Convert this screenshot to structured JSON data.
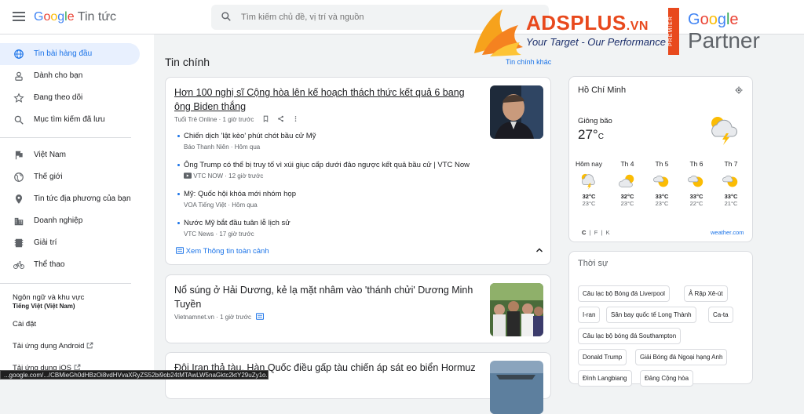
{
  "header": {
    "menu_icon": "hamburger-menu-icon",
    "logo_google": [
      "G",
      "o",
      "o",
      "g",
      "l",
      "e"
    ],
    "logo_suffix": "Tin tức",
    "search_placeholder": "Tìm kiếm chủ đề, vị trí và nguồn",
    "search_icon": "search-icon"
  },
  "watermark": {
    "brand": "ADSPLUS",
    "brand_suffix": ".VN",
    "tagline": "Your Target - Our Performance",
    "premier": "PREMIER",
    "partner_google": [
      "G",
      "o",
      "o",
      "g",
      "l",
      "e"
    ],
    "partner": "Partner"
  },
  "sidebar": {
    "items": [
      {
        "label": "Tin bài hàng đầu",
        "icon": "globe-icon",
        "active": true
      },
      {
        "label": "Dành cho bạn",
        "icon": "person-icon"
      },
      {
        "label": "Đang theo dõi",
        "icon": "star-icon"
      },
      {
        "label": "Mục tìm kiếm đã lưu",
        "icon": "search-icon"
      },
      {
        "label": "Việt Nam",
        "icon": "flag-icon"
      },
      {
        "label": "Thế giới",
        "icon": "world-icon"
      },
      {
        "label": "Tin tức địa phương của bạn",
        "icon": "location-pin-icon"
      },
      {
        "label": "Doanh nghiệp",
        "icon": "building-icon"
      },
      {
        "label": "Giải trí",
        "icon": "film-icon"
      },
      {
        "label": "Thể thao",
        "icon": "bicycle-icon"
      }
    ],
    "lang_label": "Ngôn ngữ và khu vực",
    "lang_value": "Tiếng Việt (Việt Nam)",
    "settings": "Cài đặt",
    "android": "Tải ứng dụng Android",
    "ios": "Tải ứng dụng iOS"
  },
  "main": {
    "title": "Tin chính",
    "more": "Tin chính khác",
    "story1": {
      "headline": "Hơn 100 nghị sĩ Cộng hòa lên kế hoạch thách thức kết quả 6 bang ông Biden thắng",
      "source": "Tuổi Trẻ Online",
      "time": "1 giờ trước",
      "related": [
        {
          "title": "Chiến dịch 'lật kèo' phút chót bầu cử Mỹ",
          "source": "Báo Thanh Niên",
          "time": "Hôm qua"
        },
        {
          "title": "Ông Trump có thể bị truy tố vì xúi giục cấp dưới đảo ngược kết quả bầu cử | VTC Now",
          "source": "VTC NOW",
          "time": "12 giờ trước"
        },
        {
          "title": "Mỹ: Quốc hội khóa mới nhóm họp",
          "source": "VOA Tiếng Việt",
          "time": "Hôm qua"
        },
        {
          "title": "Nước Mỹ bắt đầu tuân lễ lịch sử",
          "source": "VTC News",
          "time": "17 giờ trước"
        }
      ],
      "coverage": "Xem Thông tin toàn cảnh"
    },
    "story2": {
      "headline": "Nổ súng ở Hải Dương, kẻ lạ mặt nhâm vào 'thánh chửi' Dương Minh Tuyền",
      "source": "Vietnamnet.vn",
      "time": "1 giờ trước"
    },
    "story3": {
      "headline": "Đội Iran thả tàu, Hàn Quốc điều gấp tàu chiến áp sát eo biển Hormuz"
    }
  },
  "weather": {
    "city": "Hồ Chí Minh",
    "condition": "Giông bão",
    "temp": "27°",
    "unit": "C",
    "days": [
      {
        "name": "Hôm nay",
        "hi": "32°C",
        "lo": "23°C",
        "icon": "storm-icon"
      },
      {
        "name": "Th 4",
        "hi": "32°C",
        "lo": "23°C",
        "icon": "partly-cloudy-icon"
      },
      {
        "name": "Th 5",
        "hi": "33°C",
        "lo": "23°C",
        "icon": "partly-cloudy-icon"
      },
      {
        "name": "Th 6",
        "hi": "33°C",
        "lo": "22°C",
        "icon": "partly-cloudy-icon"
      },
      {
        "name": "Th 7",
        "hi": "33°C",
        "lo": "21°C",
        "icon": "partly-cloudy-icon"
      }
    ],
    "units_c": "C",
    "units_f": "F",
    "units_k": "K",
    "source": "weather.com"
  },
  "topics": {
    "title": "Thời sự",
    "chips": [
      "Câu lạc bộ Bóng đá Liverpool",
      "Ả Rập Xê-út",
      "I-ran",
      "Sân bay quốc tế Long Thành",
      "Ca-ta",
      "Câu lạc bộ bóng đá Southampton",
      "Donald Trump",
      "Giải Bóng đá Ngoại hạng Anh",
      "Đình Langbiang",
      "Đảng Cộng hòa"
    ]
  },
  "status_url": "...google.com/.../CBMieGh0dHBzOi8vdHVvaXRyZS52bi9ob24tMTAwLW5naGktc2ktY29uZy1o...",
  "colors": {
    "accent": "#1a73e8",
    "active_bg": "#e8f0fe",
    "brand_orange": "#e8491d"
  }
}
